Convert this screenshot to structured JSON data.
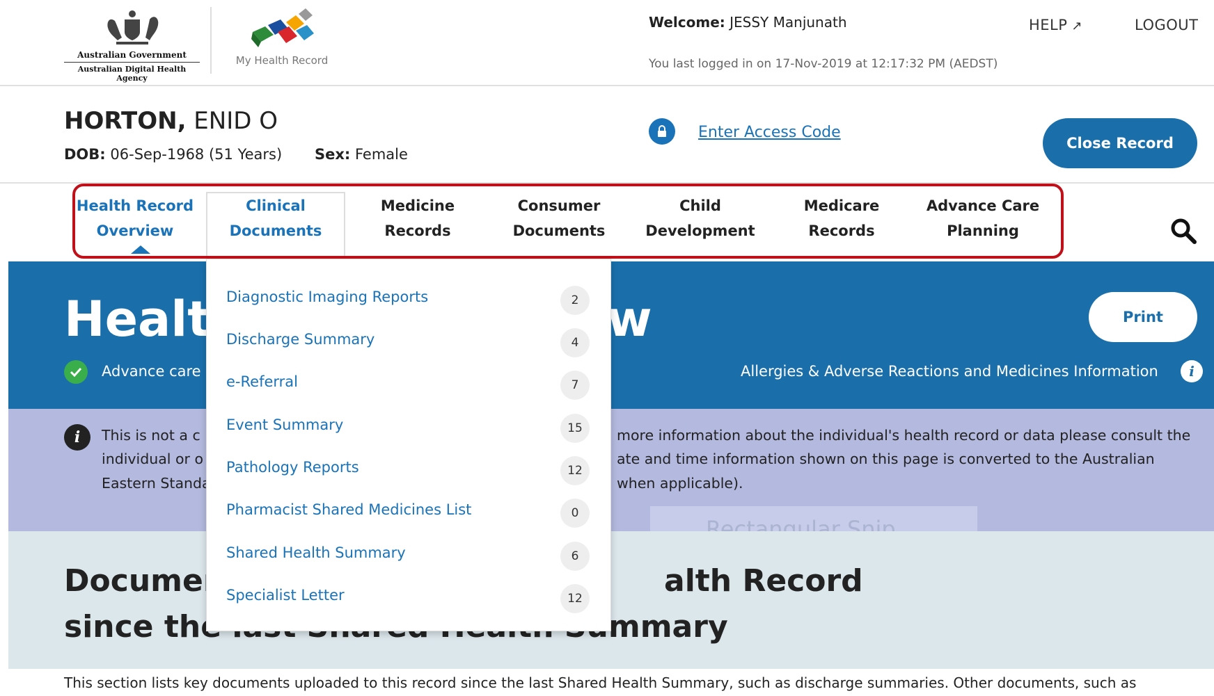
{
  "header": {
    "gov_name": "Australian Government",
    "agency_name": "Australian Digital Health Agency",
    "mhr_name": "My Health Record",
    "welcome_label": "Welcome:",
    "welcome_user": "JESSY Manjunath",
    "last_login": "You last logged in on 17-Nov-2019 at 12:17:32 PM (AEDST)",
    "help": "HELP",
    "logout": "LOGOUT"
  },
  "patient": {
    "surname": "HORTON,",
    "given": "ENID O",
    "dob_label": "DOB:",
    "dob": "06-Sep-1968 (51 Years)",
    "sex_label": "Sex:",
    "sex": "Female",
    "access_code": "Enter Access Code",
    "close_record": "Close Record"
  },
  "tabs": [
    {
      "line1": "Health Record",
      "line2": "Overview"
    },
    {
      "line1": "Clinical",
      "line2": "Documents"
    },
    {
      "line1": "Medicine",
      "line2": "Records"
    },
    {
      "line1": "Consumer",
      "line2": "Documents"
    },
    {
      "line1": "Child",
      "line2": "Development"
    },
    {
      "line1": "Medicare",
      "line2": "Records"
    },
    {
      "line1": "Advance Care",
      "line2": "Planning"
    }
  ],
  "hero": {
    "title_start": "Healt",
    "title_end": "w",
    "print": "Print",
    "advance_text": "Advance care i",
    "allergies_text": "Allergies & Adverse Reactions and Medicines Information"
  },
  "notice": {
    "line1_left": "This is not a c",
    "line1_right": "more information about the individual's health record or data please consult the",
    "line2_left": "individual or o",
    "line2_right": "ate and time information shown on this page is converted to the Australian",
    "line3_left": "Eastern Standa",
    "line3_right": "when applicable)."
  },
  "documents": {
    "heading1_left": "Documen",
    "heading1_right": "alth Record",
    "heading2": "since the last Shared Health Summary",
    "body": "This section lists key documents uploaded to this record since the last Shared Health Summary, such as discharge summaries. Other documents, such as"
  },
  "snip_ghost": "Rectangular Snip",
  "dropdown": [
    {
      "label": "Diagnostic Imaging Reports",
      "count": "2"
    },
    {
      "label": "Discharge Summary",
      "count": "4"
    },
    {
      "label": "e-Referral",
      "count": "7"
    },
    {
      "label": "Event Summary",
      "count": "15"
    },
    {
      "label": "Pathology Reports",
      "count": "12"
    },
    {
      "label": "Pharmacist Shared Medicines List",
      "count": "0"
    },
    {
      "label": "Shared Health Summary",
      "count": "6"
    },
    {
      "label": "Specialist Letter",
      "count": "12"
    }
  ],
  "colors": {
    "brand_blue": "#1a6fab",
    "link_blue": "#1a73b8",
    "highlight_red": "#c0111a",
    "notice_bg": "#b3b9df",
    "docs_bg": "#dce7ec"
  }
}
